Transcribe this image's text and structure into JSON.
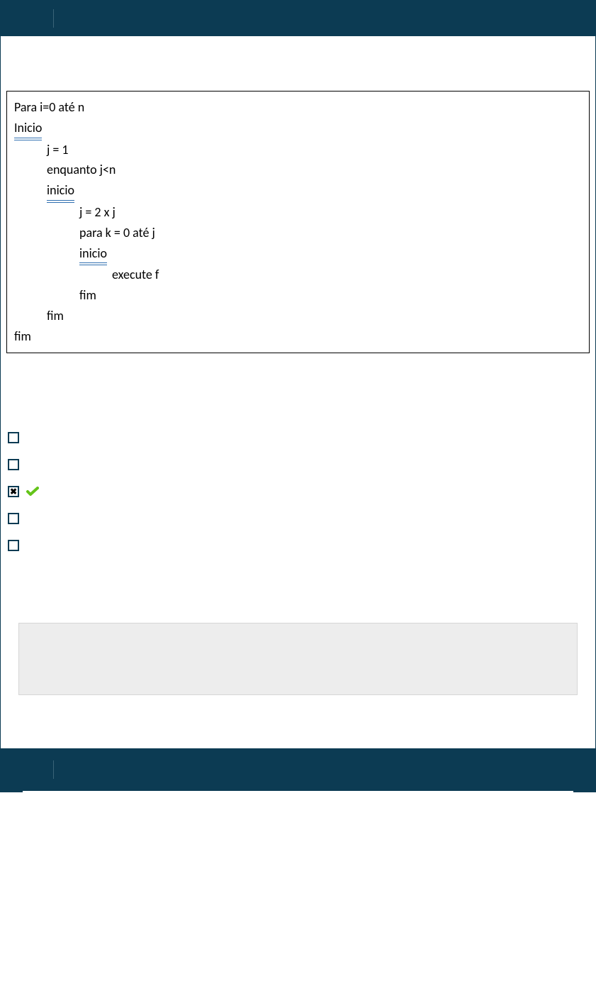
{
  "code": {
    "lines": [
      {
        "text": "Para i=0 até n",
        "indent": 0,
        "underline": false
      },
      {
        "text": "Inicio",
        "indent": 0,
        "underline": true
      },
      {
        "text": "j = 1",
        "indent": 1,
        "underline": false
      },
      {
        "text": "enquanto j<n",
        "indent": 1,
        "underline": false
      },
      {
        "text": "inicio",
        "indent": 1,
        "underline": true
      },
      {
        "text": "j = 2 x j",
        "indent": 2,
        "underline": false
      },
      {
        "text": "para k = 0 até j",
        "indent": 2,
        "underline": false
      },
      {
        "text": "inicio",
        "indent": 2,
        "underline": true
      },
      {
        "text": "execute f",
        "indent": 3,
        "underline": false
      },
      {
        "text": "fim",
        "indent": 2,
        "underline": false
      },
      {
        "text": "fim",
        "indent": 1,
        "underline": false
      },
      {
        "text": "fim",
        "indent": 0,
        "underline": false
      }
    ]
  },
  "options": [
    {
      "checked": false,
      "correct": false
    },
    {
      "checked": false,
      "correct": false
    },
    {
      "checked": true,
      "correct": true
    },
    {
      "checked": false,
      "correct": false
    },
    {
      "checked": false,
      "correct": false
    }
  ]
}
